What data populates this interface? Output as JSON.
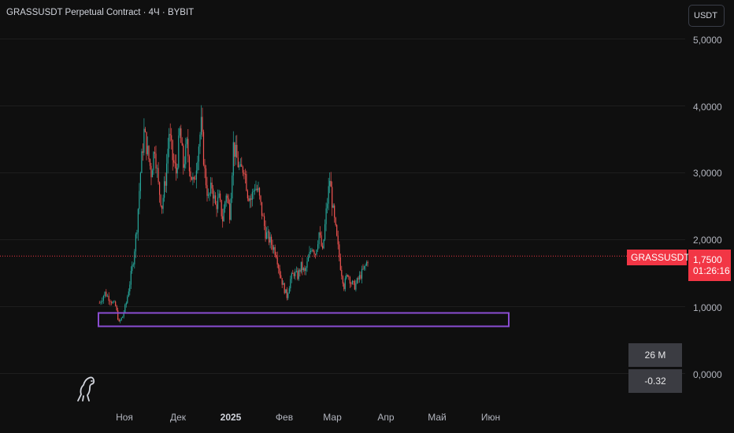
{
  "title": "GRASSUSDT Perpetual Contract · 4Ч · BYBIT",
  "currency_button": "USDT",
  "y_axis": {
    "ticks": [
      "5,0000",
      "4,0000",
      "3,0000",
      "2,0000",
      "1,0000",
      "0,0000"
    ]
  },
  "x_axis": {
    "ticks": [
      "Ноя",
      "Дек",
      "2025",
      "Фев",
      "Мар",
      "Апр",
      "Май",
      "Июн"
    ],
    "bold_tick": "2025"
  },
  "price_label": {
    "symbol": "GRASSUSDT.P",
    "price": "1,7500",
    "countdown": "01:26:16"
  },
  "gray_labels": {
    "volume": "26 M",
    "change": "-0.32"
  },
  "logo_icon": "dinosaur-icon",
  "colors": {
    "background": "#0f0f0f",
    "up_candle": "#26a69a",
    "down_candle": "#ef5350",
    "last_price": "#f23645",
    "zone_box": "#8a4dd1",
    "grid": "#1e1e1e"
  },
  "chart_data": {
    "type": "candlestick",
    "last_price": 1.75,
    "y_range": [
      0,
      5
    ],
    "x_axis_months": [
      "Ноя",
      "Дек",
      "2025",
      "Фев",
      "Мар",
      "Апр",
      "Май",
      "Июн"
    ],
    "price_path": [
      [
        "2024-10-18",
        1.05
      ],
      [
        "2024-10-21",
        1.2
      ],
      [
        "2024-10-24",
        1.1
      ],
      [
        "2024-10-27",
        1.0
      ],
      [
        "2024-10-29",
        0.75
      ],
      [
        "2024-10-31",
        0.85
      ],
      [
        "2024-11-02",
        1.05
      ],
      [
        "2024-11-04",
        1.35
      ],
      [
        "2024-11-06",
        1.7
      ],
      [
        "2024-11-08",
        2.2
      ],
      [
        "2024-11-10",
        3.0
      ],
      [
        "2024-11-12",
        3.6
      ],
      [
        "2024-11-14",
        3.3
      ],
      [
        "2024-11-16",
        3.0
      ],
      [
        "2024-11-18",
        3.4
      ],
      [
        "2024-11-20",
        2.8
      ],
      [
        "2024-11-22",
        2.5
      ],
      [
        "2024-11-24",
        2.9
      ],
      [
        "2024-11-26",
        3.6
      ],
      [
        "2024-11-28",
        3.2
      ],
      [
        "2024-11-30",
        3.0
      ],
      [
        "2024-12-02",
        3.6
      ],
      [
        "2024-12-04",
        3.1
      ],
      [
        "2024-12-06",
        3.4
      ],
      [
        "2024-12-08",
        3.0
      ],
      [
        "2024-12-10",
        2.8
      ],
      [
        "2024-12-12",
        3.3
      ],
      [
        "2024-12-14",
        3.7
      ],
      [
        "2024-12-16",
        3.0
      ],
      [
        "2024-12-18",
        2.6
      ],
      [
        "2024-12-20",
        2.8
      ],
      [
        "2024-12-22",
        2.5
      ],
      [
        "2024-12-24",
        2.6
      ],
      [
        "2024-12-26",
        2.3
      ],
      [
        "2024-12-28",
        2.7
      ],
      [
        "2024-12-30",
        2.4
      ],
      [
        "2025-01-01",
        3.4
      ],
      [
        "2025-01-03",
        3.2
      ],
      [
        "2025-01-05",
        3.0
      ],
      [
        "2025-01-07",
        3.1
      ],
      [
        "2025-01-09",
        2.7
      ],
      [
        "2025-01-11",
        2.6
      ],
      [
        "2025-01-13",
        2.8
      ],
      [
        "2025-01-15",
        2.7
      ],
      [
        "2025-01-17",
        2.4
      ],
      [
        "2025-01-19",
        2.1
      ],
      [
        "2025-01-21",
        2.0
      ],
      [
        "2025-01-23",
        1.9
      ],
      [
        "2025-01-25",
        1.8
      ],
      [
        "2025-01-27",
        1.5
      ],
      [
        "2025-01-29",
        1.3
      ],
      [
        "2025-01-31",
        1.15
      ],
      [
        "2025-02-02",
        1.4
      ],
      [
        "2025-02-04",
        1.5
      ],
      [
        "2025-02-06",
        1.45
      ],
      [
        "2025-02-08",
        1.6
      ],
      [
        "2025-02-10",
        1.5
      ],
      [
        "2025-02-12",
        1.7
      ],
      [
        "2025-02-14",
        1.9
      ],
      [
        "2025-02-16",
        1.8
      ],
      [
        "2025-02-18",
        2.1
      ],
      [
        "2025-02-20",
        1.8
      ],
      [
        "2025-02-22",
        2.4
      ],
      [
        "2025-02-24",
        2.9
      ],
      [
        "2025-02-26",
        2.4
      ],
      [
        "2025-02-28",
        2.0
      ],
      [
        "2025-03-02",
        1.6
      ],
      [
        "2025-03-04",
        1.3
      ],
      [
        "2025-03-06",
        1.5
      ],
      [
        "2025-03-08",
        1.35
      ],
      [
        "2025-03-10",
        1.3
      ],
      [
        "2025-03-12",
        1.4
      ],
      [
        "2025-03-14",
        1.5
      ],
      [
        "2025-03-16",
        1.6
      ],
      [
        "2025-03-18",
        1.75
      ]
    ],
    "zones": [
      {
        "from": "2024-10-18",
        "to": "2025-06-15",
        "low": 0.7,
        "high": 0.9,
        "color": "#8a4dd1"
      }
    ]
  }
}
